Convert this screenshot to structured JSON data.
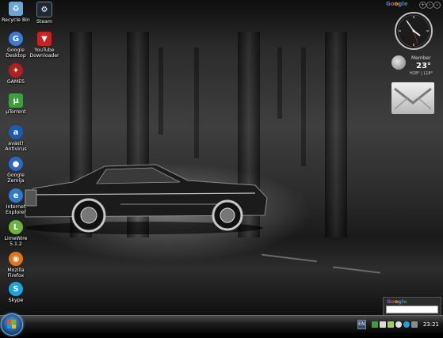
{
  "desktop_icons": [
    {
      "label": "Recycle Bin",
      "icon": "recycle-bin-icon",
      "color": "#6aa7d8"
    },
    {
      "label": "Steam",
      "icon": "steam-icon",
      "color": "#1b2838"
    },
    {
      "label": "Google\nDesktop",
      "icon": "google-desktop-icon",
      "color": "#3d7ad6"
    },
    {
      "label": "YouTube\nDownloader",
      "icon": "youtube-downloader-icon",
      "color": "#d01e1e"
    },
    {
      "label": "GAMES",
      "icon": "games-icon",
      "color": "#b11f1f"
    },
    {
      "label": "µTorrent",
      "icon": "utorrent-icon",
      "color": "#3aa03a"
    },
    {
      "label": "avast!\nAntivirus",
      "icon": "avast-icon",
      "color": "#1d5bb3"
    },
    {
      "label": "Google\nZemlja",
      "icon": "google-earth-icon",
      "color": "#2a66c4"
    },
    {
      "label": "Internet\nExplorer",
      "icon": "internet-explorer-icon",
      "color": "#2f7ad0"
    },
    {
      "label": "LimeWire\n5.1.2",
      "icon": "limewire-icon",
      "color": "#6db33f"
    },
    {
      "label": "Mozilla\nFirefox",
      "icon": "firefox-icon",
      "color": "#e3731b"
    },
    {
      "label": "Skype",
      "icon": "skype-icon",
      "color": "#1aa3e0"
    }
  ],
  "sidebar": {
    "google_logo": "Google",
    "weather": {
      "location": "Member",
      "temp": "23°",
      "highlow": "H28° | L18°"
    }
  },
  "search_gadget": {
    "logo": "Google",
    "placeholder": ""
  },
  "taskbar": {
    "clock": "23:21",
    "lang": "EN"
  },
  "colors": {
    "taskbar": "#1c1c1c",
    "start_orb": "#1b4f8c"
  }
}
